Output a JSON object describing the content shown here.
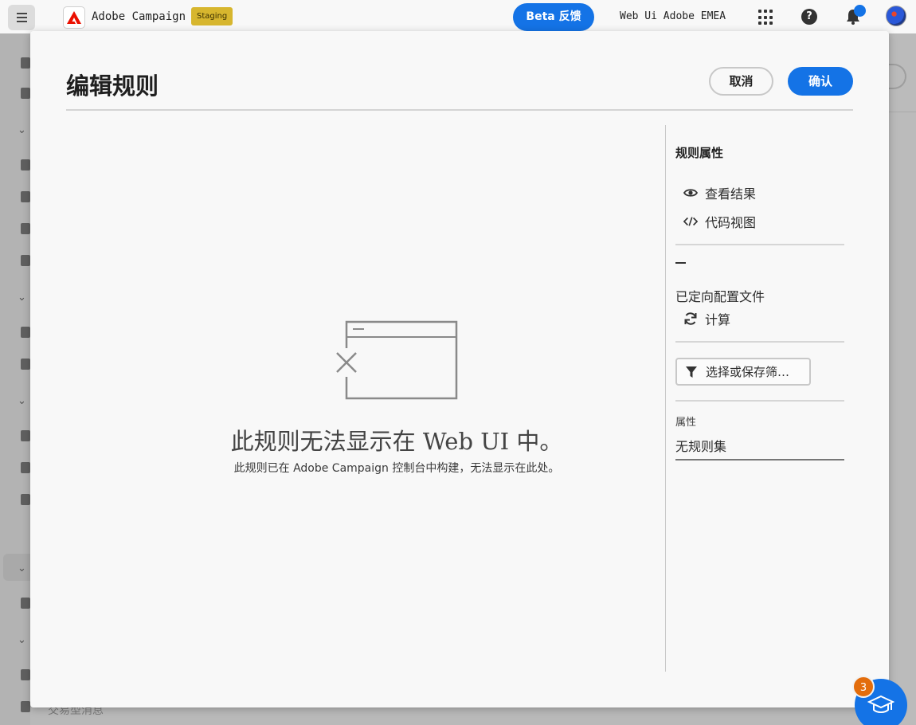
{
  "header": {
    "app_name": "Adobe Campaign",
    "env_badge": "Staging",
    "beta_label": "Beta 反馈",
    "org_name": "Web Ui Adobe EMEA",
    "icons": [
      "menu-icon",
      "adobe-logo-icon",
      "apps-grid-icon",
      "help-icon",
      "bell-icon",
      "avatar"
    ]
  },
  "background": {
    "sidebar_partial_text": "交易型消息"
  },
  "modal": {
    "title": "编辑规则",
    "cancel_label": "取消",
    "confirm_label": "确认",
    "empty_state": {
      "title": "此规则无法显示在 Web UI 中。",
      "subtitle": "此规则已在 Adobe Campaign 控制台中构建，无法显示在此处。"
    },
    "panel": {
      "heading": "规则属性",
      "view_results": "查看结果",
      "code_view": "代码视图",
      "count_value": "—",
      "targeting_dimension": "已定向配置文件",
      "compute_label": "计算",
      "filter_button": "选择或保存筛…",
      "property_label": "属性",
      "property_value": "无规则集"
    }
  },
  "fab": {
    "badge_count": "3"
  },
  "colors": {
    "accent": "#1473e6",
    "badge": "#d7b62e",
    "fab_badge": "#e36d0c"
  }
}
